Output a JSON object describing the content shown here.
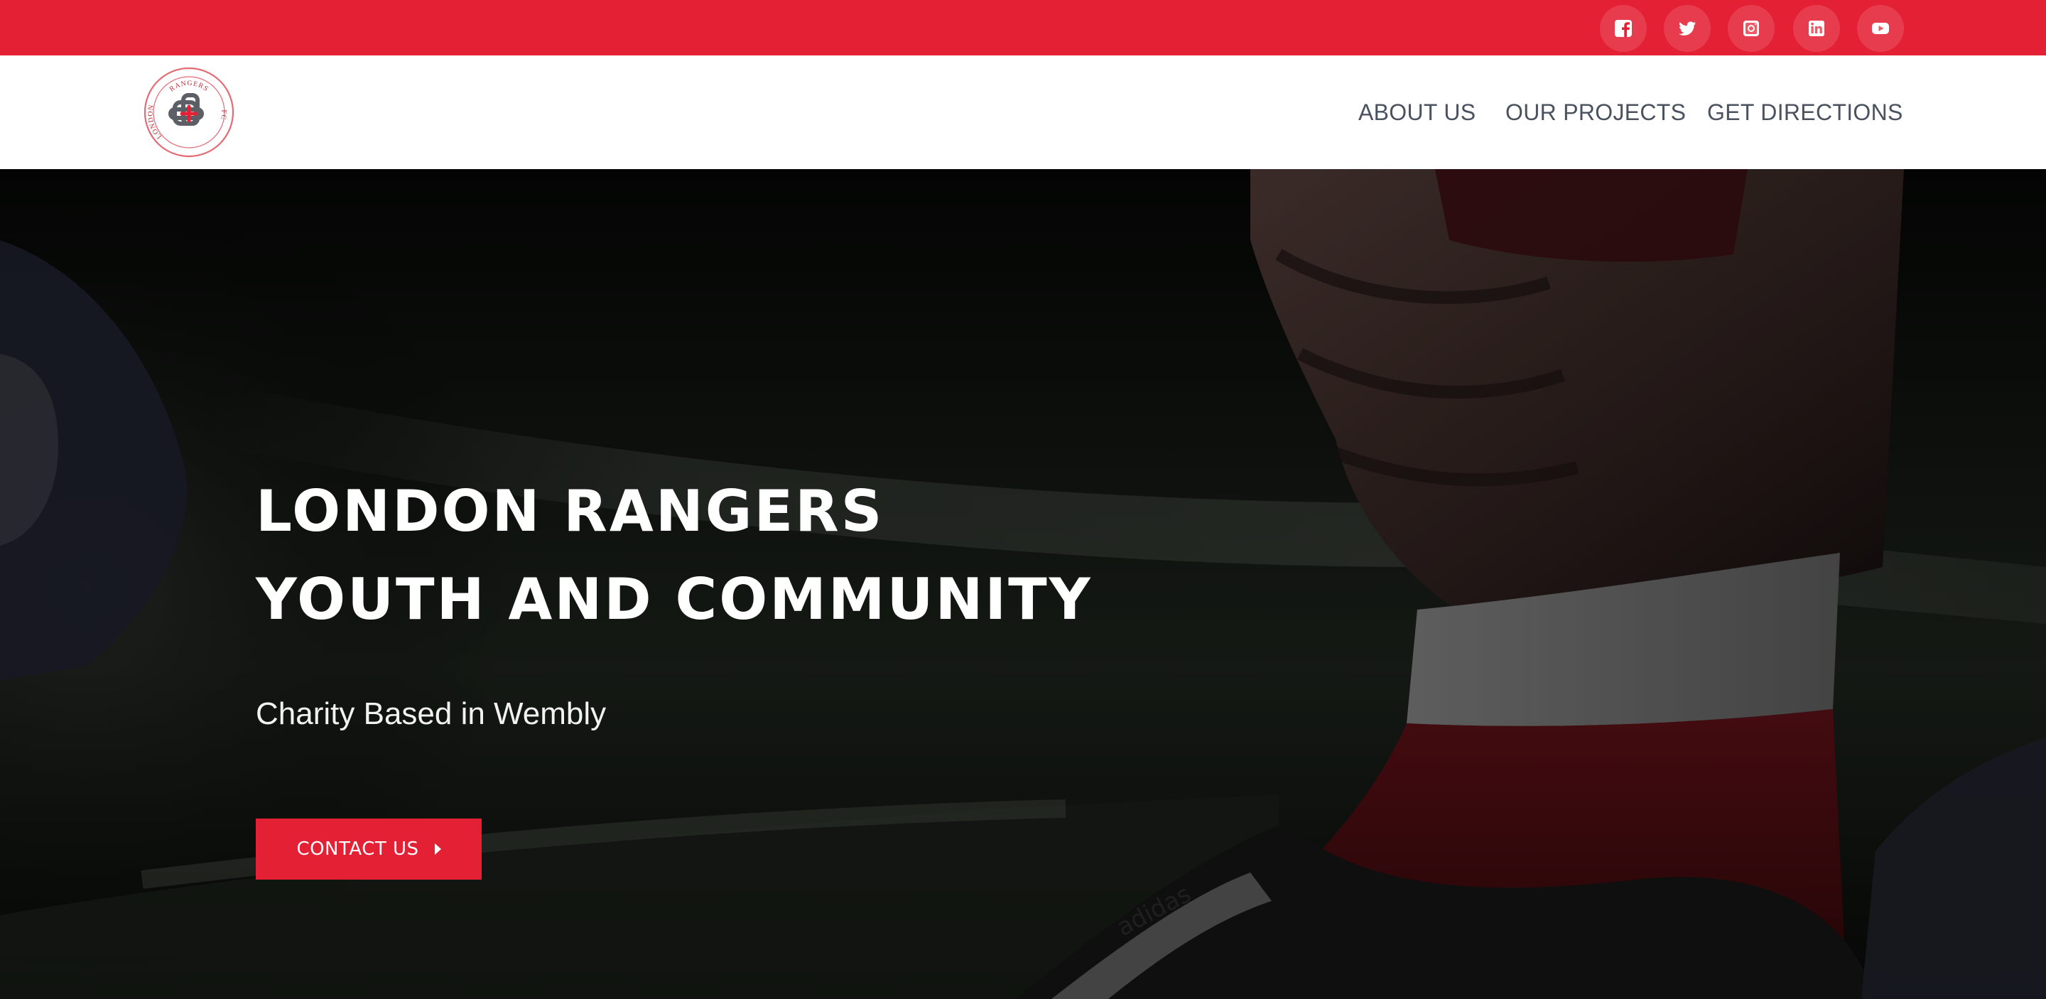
{
  "social": {
    "facebook": "facebook-icon",
    "twitter": "twitter-icon",
    "instagram": "instagram-icon",
    "linkedin": "linkedin-icon",
    "youtube": "youtube-icon"
  },
  "logo": {
    "arc_top": "RANGERS",
    "arc_left": "LONDON",
    "arc_right": "FC"
  },
  "nav": {
    "items": [
      {
        "label": "ABOUT US"
      },
      {
        "label": "OUR PROJECTS"
      },
      {
        "label": "GET DIRECTIONS"
      }
    ]
  },
  "hero": {
    "title_line1": "LONDON RANGERS",
    "title_line2": "YOUTH AND COMMUNITY",
    "subtitle": "Charity Based in Wembly",
    "cta_label": "CONTACT US",
    "cta_icon": "caret-right-icon",
    "background_image": "football-player-sock-boot-photo",
    "background_brand_text": "adidas"
  },
  "colors": {
    "brand_red": "#e42034",
    "nav_text": "#4a5260",
    "white": "#ffffff"
  }
}
